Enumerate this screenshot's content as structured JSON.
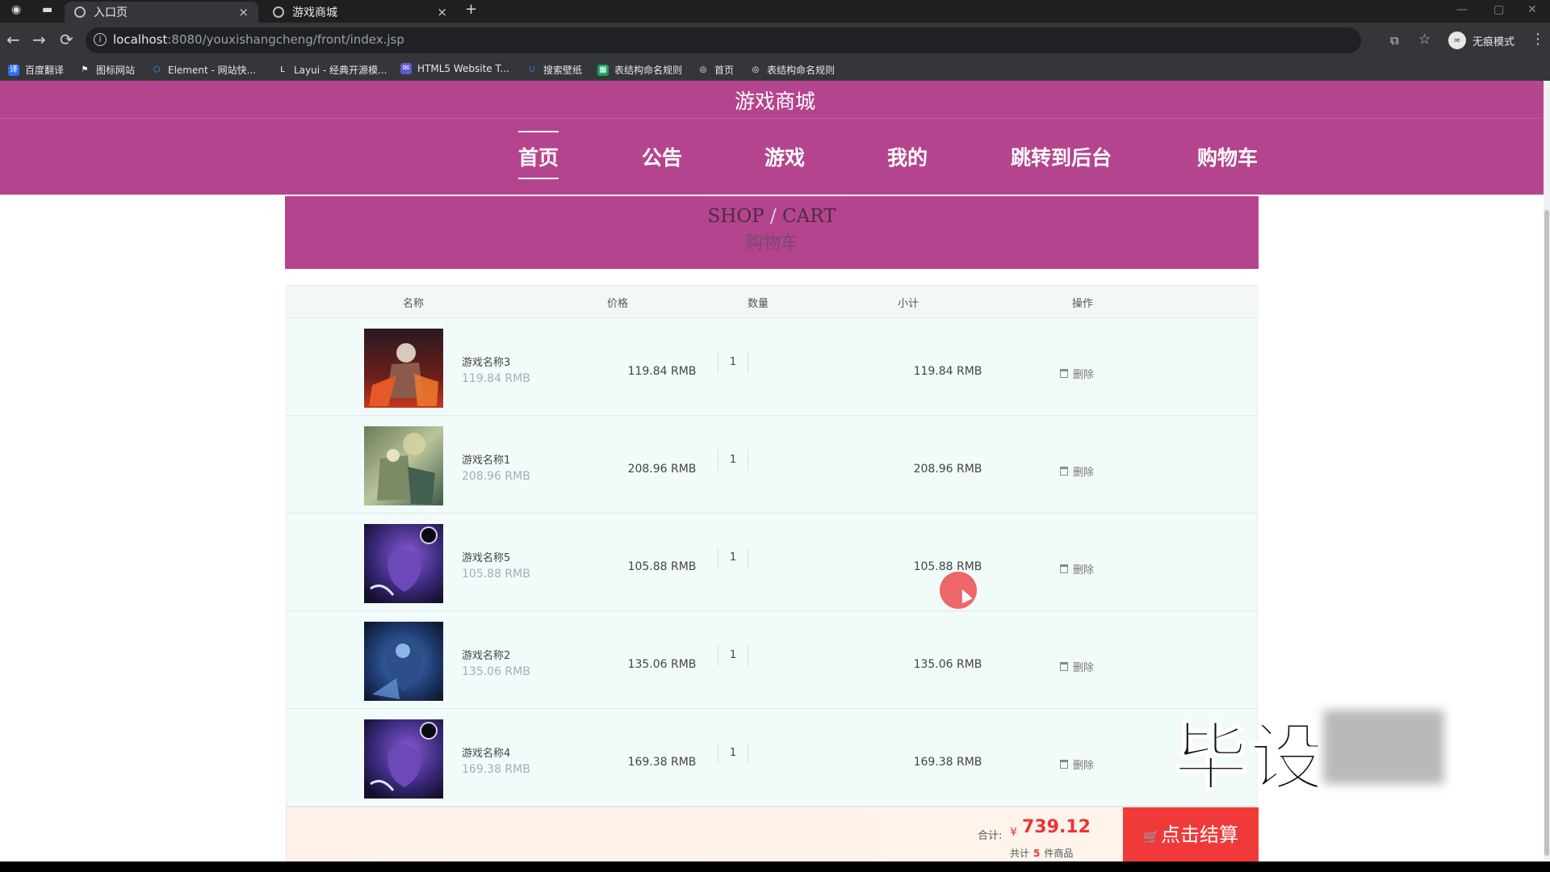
{
  "browser": {
    "tabs": [
      {
        "title": "入口页",
        "close": "×"
      },
      {
        "title": "游戏商城",
        "close": "×"
      }
    ],
    "new_tab": "+",
    "back": "←",
    "forward": "→",
    "reload": "⟳",
    "info": "i",
    "url_host": "localhost",
    "url_path": ":8080/youxishangcheng/front/index.jsp",
    "translate": "⧉",
    "star": "☆",
    "incognito_avatar": "∞",
    "incognito_label": "无痕模式",
    "menu": "⋮",
    "bookmarks": [
      {
        "label": "百度翻译",
        "color": "#2f6ff2",
        "glyph": "译"
      },
      {
        "label": "图标网站",
        "color": "#35363a",
        "glyph": "⚑"
      },
      {
        "label": "Element - 网站快...",
        "color": "#409eff",
        "glyph": "⬡"
      },
      {
        "label": "Layui - 经典开源模...",
        "color": "#35363a",
        "glyph": "L"
      },
      {
        "label": "HTML5 Website T...",
        "color": "#5b5bd6",
        "glyph": "✉"
      },
      {
        "label": "搜索壁纸",
        "color": "#3a6fd8",
        "glyph": "U"
      },
      {
        "label": "表结构命名规则",
        "color": "#1aa260",
        "glyph": "▦"
      },
      {
        "label": "首页",
        "color": "#35363a",
        "glyph": "◎"
      },
      {
        "label": "表结构命名规则",
        "color": "#35363a",
        "glyph": "◎"
      }
    ]
  },
  "site": {
    "title": "游戏商城",
    "nav": [
      "首页",
      "公告",
      "游戏",
      "我的",
      "跳转到后台",
      "购物车"
    ],
    "active_nav": 0
  },
  "banner": {
    "en_left": "SHOP",
    "en_sep": " / ",
    "en_right": "CART",
    "cn": "购物车"
  },
  "cart": {
    "headers": [
      "名称",
      "价格",
      "数量",
      "小计",
      "操作"
    ],
    "items": [
      {
        "name": "游戏名称3",
        "price": "119.84 RMB",
        "qty": "1",
        "subtotal": "119.84 RMB",
        "action": "删除",
        "image": "game-art-fire"
      },
      {
        "name": "游戏名称1",
        "price": "208.96 RMB",
        "qty": "1",
        "subtotal": "208.96 RMB",
        "action": "删除",
        "image": "game-art-forest"
      },
      {
        "name": "游戏名称5",
        "price": "105.88 RMB",
        "qty": "1",
        "subtotal": "105.88 RMB",
        "action": "删除",
        "image": "game-art-void"
      },
      {
        "name": "游戏名称2",
        "price": "135.06 RMB",
        "qty": "1",
        "subtotal": "135.06 RMB",
        "action": "删除",
        "image": "game-art-frost"
      },
      {
        "name": "游戏名称4",
        "price": "169.38 RMB",
        "qty": "1",
        "subtotal": "169.38 RMB",
        "action": "删除",
        "image": "game-art-void"
      }
    ],
    "total_label": "合计:",
    "currency": "¥",
    "total": "739.12",
    "count_prefix": "共计",
    "count": "5",
    "count_suffix": "件商品",
    "checkout": "点击结算",
    "checkout_icon": "🛒"
  },
  "overlay": {
    "watermark": "毕设"
  },
  "colors": {
    "brand": "#b5448f",
    "accent_red": "#f03a3a"
  }
}
